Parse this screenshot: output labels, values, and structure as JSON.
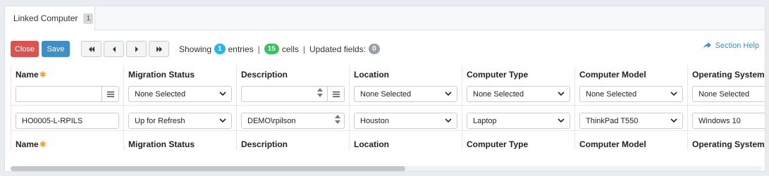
{
  "tab": {
    "label": "Linked Computer",
    "count": "1"
  },
  "toolbar": {
    "close_label": "Close",
    "save_label": "Save"
  },
  "status": {
    "showing_label": "Showing",
    "entries_count": "1",
    "entries_label": "entries",
    "cells_count": "15",
    "cells_label": "cells",
    "updated_label": "Updated fields:",
    "updated_count": "0",
    "separator": "|"
  },
  "help": {
    "label": "Section Help"
  },
  "columns": [
    {
      "header": "Name",
      "required": true,
      "filter": "",
      "value": "HO0005-L-RPILS"
    },
    {
      "header": "Migration Status",
      "filter": "None Selected",
      "value": "Up for Refresh"
    },
    {
      "header": "Description",
      "filter": "",
      "value": "DEMO\\rpilson"
    },
    {
      "header": "Location",
      "filter": "None Selected",
      "value": "Houston"
    },
    {
      "header": "Computer Type",
      "filter": "None Selected",
      "value": "Laptop"
    },
    {
      "header": "Computer Model",
      "filter": "None Selected",
      "value": "ThinkPad T550"
    },
    {
      "header": "Operating System",
      "filter": "None Selected",
      "value": "Windows 10"
    }
  ],
  "required_mark": "✱",
  "colors": {
    "close": "#d9534f",
    "save": "#3d8ec9",
    "entries_pill": "#2ab3e6",
    "cells_pill": "#37c25e",
    "updated_pill": "#9aa0a6",
    "required": "#f0a020"
  }
}
